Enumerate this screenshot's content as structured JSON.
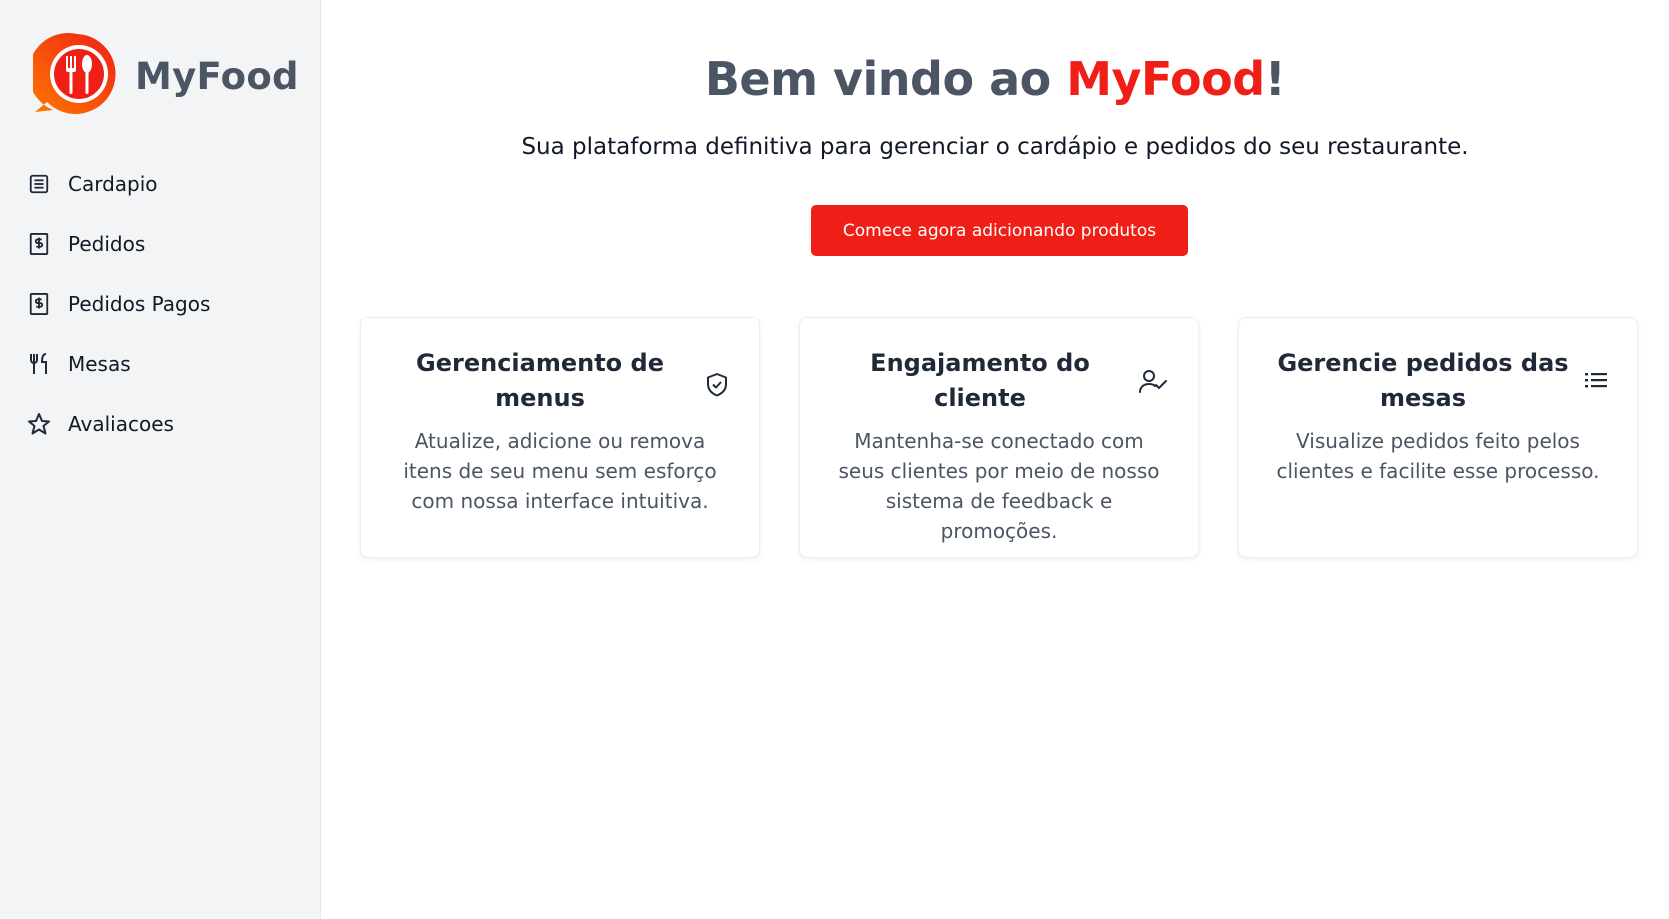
{
  "app": {
    "brand_name": "MyFood",
    "accent_color": "#ef1f17",
    "logo_icon": "restaurant-logo-icon"
  },
  "sidebar": {
    "items": [
      {
        "label": "Cardapio",
        "icon": "menu-list-icon"
      },
      {
        "label": "Pedidos",
        "icon": "receipt-dollar-icon"
      },
      {
        "label": "Pedidos Pagos",
        "icon": "receipt-dollar-icon"
      },
      {
        "label": "Mesas",
        "icon": "fork-knife-icon"
      },
      {
        "label": "Avaliacoes",
        "icon": "star-icon"
      }
    ]
  },
  "hero": {
    "title_prefix": "Bem vindo ao ",
    "title_brand": "MyFood",
    "title_suffix": "!",
    "subtitle": "Sua plataforma definitiva para gerenciar o cardápio e pedidos do seu restaurante.",
    "cta_label": "Comece agora adicionando produtos"
  },
  "cards": [
    {
      "title": "Gerenciamento de menus",
      "body": "Atualize, adicione ou remova itens de seu menu sem esforço com nossa interface intuitiva.",
      "icon": "shield-check-icon"
    },
    {
      "title": "Engajamento do cliente",
      "body": "Mantenha-se conectado com seus clientes por meio de nosso sistema de feedback e promoções.",
      "icon": "user-check-icon"
    },
    {
      "title": "Gerencie pedidos das mesas",
      "body": "Visualize pedidos feito pelos clientes e facilite esse processo.",
      "icon": "list-icon"
    }
  ]
}
